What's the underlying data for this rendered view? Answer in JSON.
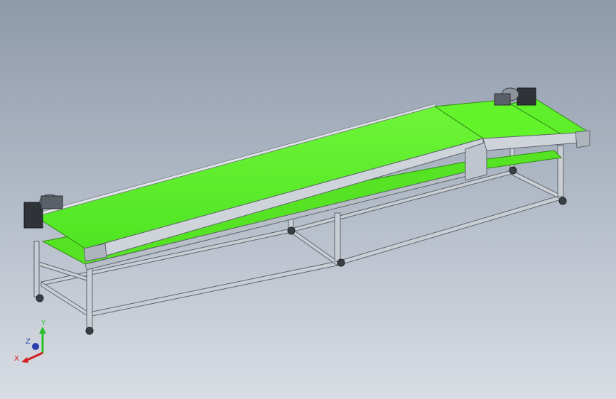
{
  "triad": {
    "x_label": "X",
    "y_label": "Y",
    "z_label": "Z",
    "x_color": "#d21e1e",
    "y_color": "#2bbf2b",
    "z_color": "#2a3fb0"
  },
  "colors": {
    "belt": "#63f32a",
    "belt_shade": "#3fd21a",
    "frame": "#c7ccd3",
    "frame_dark": "#6e747c",
    "motor": "#2f3338"
  }
}
